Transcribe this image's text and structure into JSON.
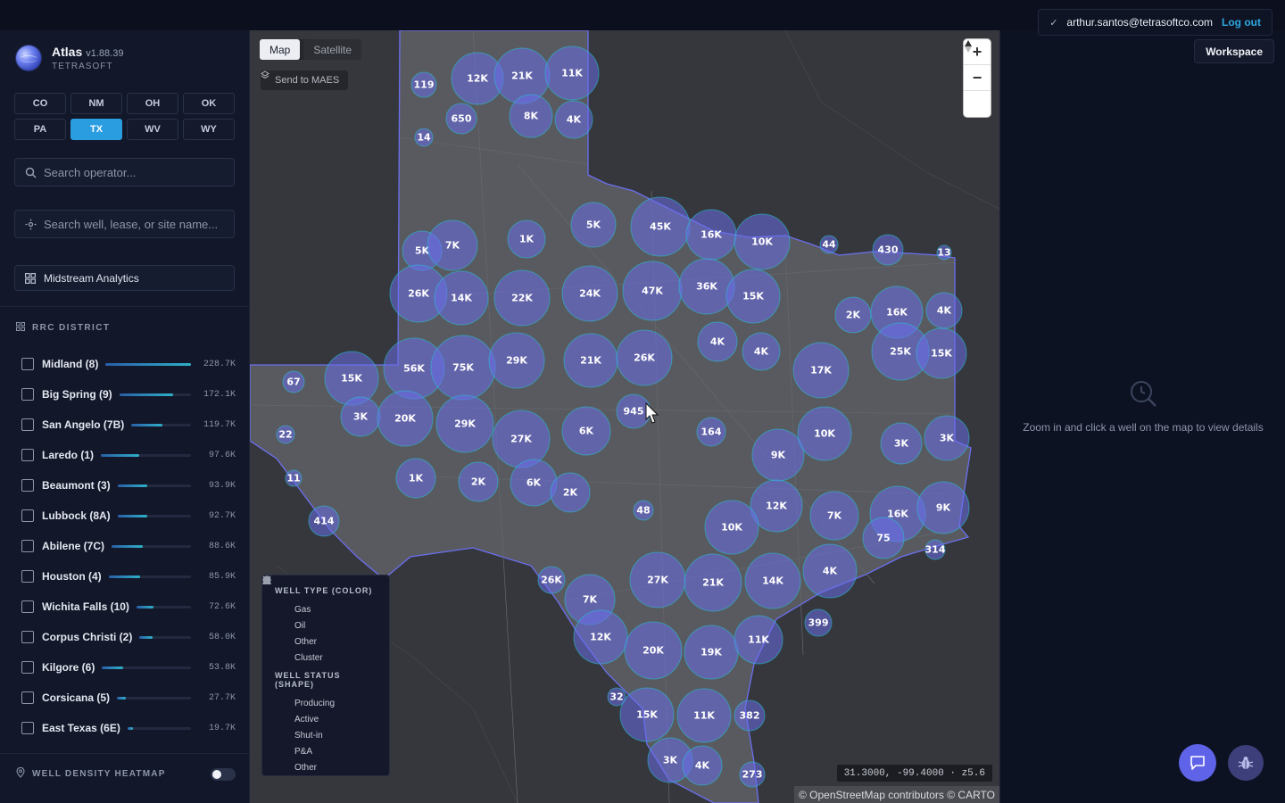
{
  "header": {
    "user_email": "arthur.santos@tetrasoftco.com",
    "logout_label": "Log out",
    "workspace_label": "Workspace"
  },
  "brand": {
    "name": "Atlas",
    "version": "v1.88.39",
    "company": "TETRASOFT"
  },
  "states": [
    {
      "code": "CO",
      "active": false
    },
    {
      "code": "NM",
      "active": false
    },
    {
      "code": "OH",
      "active": false
    },
    {
      "code": "OK",
      "active": false
    },
    {
      "code": "PA",
      "active": false
    },
    {
      "code": "TX",
      "active": true
    },
    {
      "code": "WV",
      "active": false
    },
    {
      "code": "WY",
      "active": false
    }
  ],
  "search_operator": {
    "placeholder": "Search operator..."
  },
  "search_well": {
    "placeholder": "Search well, lease, or site name..."
  },
  "analytics_label": "Midstream Analytics",
  "district_section": {
    "title": "RRC DISTRICT",
    "items": [
      {
        "name": "Midland (8)",
        "value": "228.7K",
        "fraction": 1.0
      },
      {
        "name": "Big Spring (9)",
        "value": "172.1K",
        "fraction": 0.75
      },
      {
        "name": "San Angelo (7B)",
        "value": "119.7K",
        "fraction": 0.52
      },
      {
        "name": "Laredo (1)",
        "value": "97.6K",
        "fraction": 0.43
      },
      {
        "name": "Beaumont (3)",
        "value": "93.9K",
        "fraction": 0.41
      },
      {
        "name": "Lubbock (8A)",
        "value": "92.7K",
        "fraction": 0.41
      },
      {
        "name": "Abilene (7C)",
        "value": "88.6K",
        "fraction": 0.39
      },
      {
        "name": "Houston (4)",
        "value": "85.9K",
        "fraction": 0.38
      },
      {
        "name": "Wichita Falls (10)",
        "value": "72.6K",
        "fraction": 0.32
      },
      {
        "name": "Corpus Christi (2)",
        "value": "58.0K",
        "fraction": 0.25
      },
      {
        "name": "Kilgore (6)",
        "value": "53.8K",
        "fraction": 0.24
      },
      {
        "name": "Corsicana (5)",
        "value": "27.7K",
        "fraction": 0.12
      },
      {
        "name": "East Texas (6E)",
        "value": "19.7K",
        "fraction": 0.09
      }
    ]
  },
  "heatmap": {
    "label": "WELL DENSITY HEATMAP",
    "enabled": false
  },
  "map": {
    "tabs": [
      {
        "label": "Map",
        "active": true
      },
      {
        "label": "Satellite",
        "active": false
      }
    ],
    "send_label": "Send to MAES",
    "coords": "31.3000, -99.4000 · z5.6",
    "attribution": "© OpenStreetMap contributors © CARTO",
    "clusters": [
      "119",
      "12K",
      "21K",
      "11K",
      "650",
      "8K",
      "4K",
      "14",
      "5K",
      "7K",
      "1K",
      "5K",
      "45K",
      "16K",
      "10K",
      "44",
      "430",
      "13",
      "26K",
      "14K",
      "22K",
      "24K",
      "47K",
      "36K",
      "15K",
      "2K",
      "16K",
      "4K",
      "4K",
      "4K",
      "25K",
      "15K",
      "67",
      "15K",
      "56K",
      "75K",
      "29K",
      "21K",
      "26K",
      "17K",
      "945",
      "3K",
      "20K",
      "29K",
      "27K",
      "6K",
      "164",
      "9K",
      "10K",
      "3K",
      "3K",
      "22",
      "11",
      "1K",
      "2K",
      "6K",
      "2K",
      "48",
      "12K",
      "7K",
      "16K",
      "9K",
      "414",
      "10K",
      "75",
      "314",
      "26K",
      "27K",
      "21K",
      "14K",
      "4K",
      "7K",
      "12K",
      "20K",
      "19K",
      "11K",
      "399",
      "32",
      "15K",
      "11K",
      "382",
      "3K",
      "4K",
      "273"
    ]
  },
  "legend": {
    "type_title": "WELL TYPE (COLOR)",
    "types": [
      {
        "label": "Gas",
        "color": "#22c3d6"
      },
      {
        "label": "Oil",
        "color": "#f2a628"
      },
      {
        "label": "Other",
        "color": "#9aa0ac"
      },
      {
        "label": "Cluster",
        "color": "#6a6ee8"
      }
    ],
    "status_title": "WELL STATUS (SHAPE)",
    "statuses": [
      {
        "label": "Producing",
        "icon": "triangle-icon"
      },
      {
        "label": "Active",
        "icon": "circle-icon"
      },
      {
        "label": "Shut-in",
        "icon": "square-icon"
      },
      {
        "label": "P&A",
        "icon": "diamond-icon"
      },
      {
        "label": "Other",
        "icon": "x-icon"
      }
    ]
  },
  "details": {
    "empty_message": "Zoom in and click a well on the map to view details"
  },
  "colors": {
    "accent": "#2a9de0",
    "cluster_fill": "#6a6ee8",
    "cluster_ring": "#22c3d6"
  }
}
